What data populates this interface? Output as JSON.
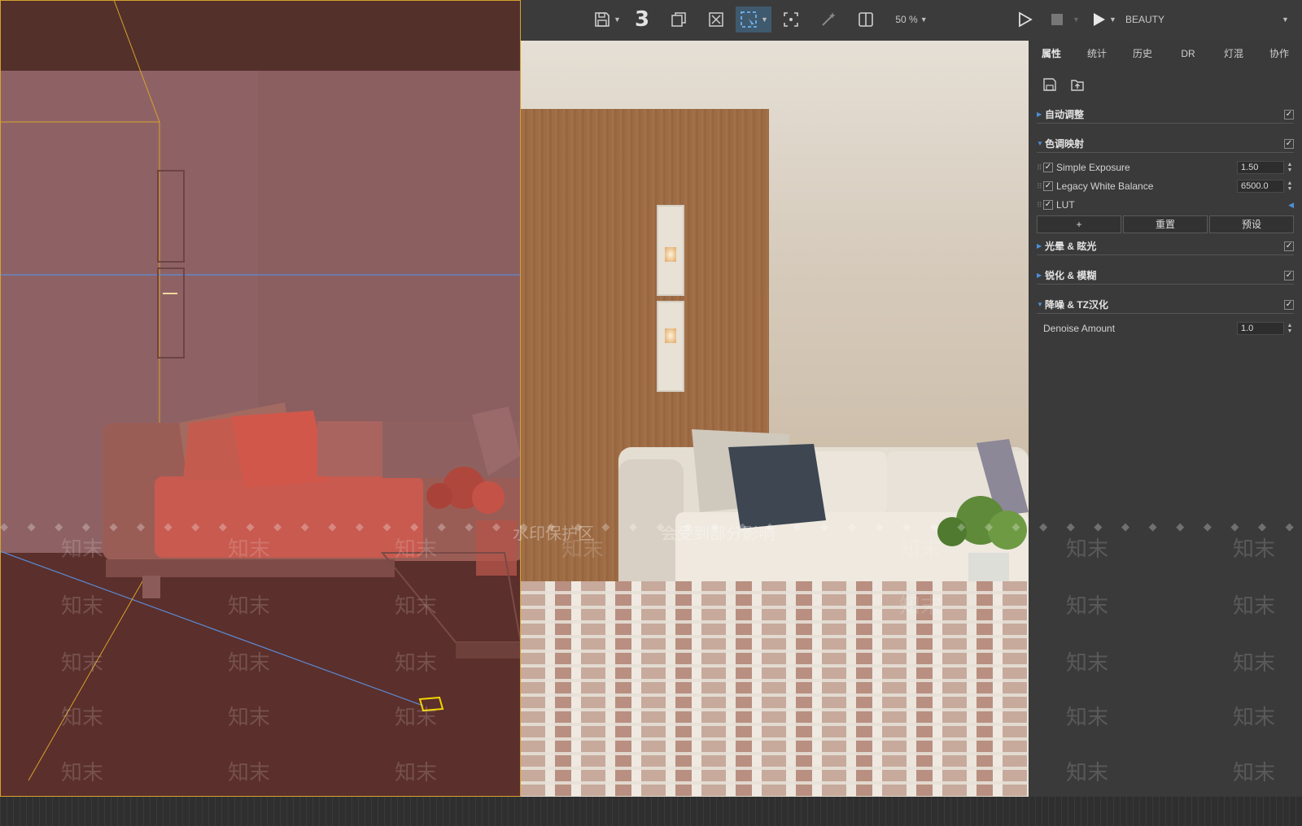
{
  "toolbar": {
    "layer_number": "3",
    "zoom_label": "50 %",
    "channel_label": "BEAUTY"
  },
  "tabs": [
    {
      "label": "属性",
      "active": true
    },
    {
      "label": "统计"
    },
    {
      "label": "历史"
    },
    {
      "label": "DR"
    },
    {
      "label": "灯混"
    },
    {
      "label": "协作"
    }
  ],
  "sections": {
    "auto_adjust": "自动调整",
    "tone_mapping": "色调映射",
    "glow_glare": "光晕 & 眩光",
    "sharpen_blur": "锐化 & 模糊",
    "denoise": "降噪 & TZ汉化"
  },
  "tone_rows": {
    "exposure_label": "Simple Exposure",
    "exposure_value": "1.50",
    "white_balance_label": "Legacy White Balance",
    "white_balance_value": "6500.0",
    "lut_label": "LUT"
  },
  "buttons": {
    "add": "+",
    "reset": "重置",
    "preset": "预设"
  },
  "denoise_row": {
    "label": "Denoise Amount",
    "value": "1.0"
  },
  "watermarks": {
    "center_left": "水印保护区",
    "center_right": "会受到部分影响",
    "brand": "知末"
  },
  "icons": {
    "save": "floppy-icon",
    "stack": "copy-icon",
    "clear": "clear-icon",
    "region": "region-select-icon",
    "focus": "focus-icon",
    "wand": "magic-wand-icon",
    "split": "split-view-icon",
    "play": "play-icon",
    "stop": "stop-icon",
    "play2": "play-filled-icon"
  },
  "colors": {
    "panel_bg": "#3a3a3a",
    "toolbar_bg": "#3b3b3b",
    "accent_blue": "#4d8fd8",
    "viewport_frame": "#d7a12e",
    "viewport_blue_line": "#5b8bd6"
  }
}
